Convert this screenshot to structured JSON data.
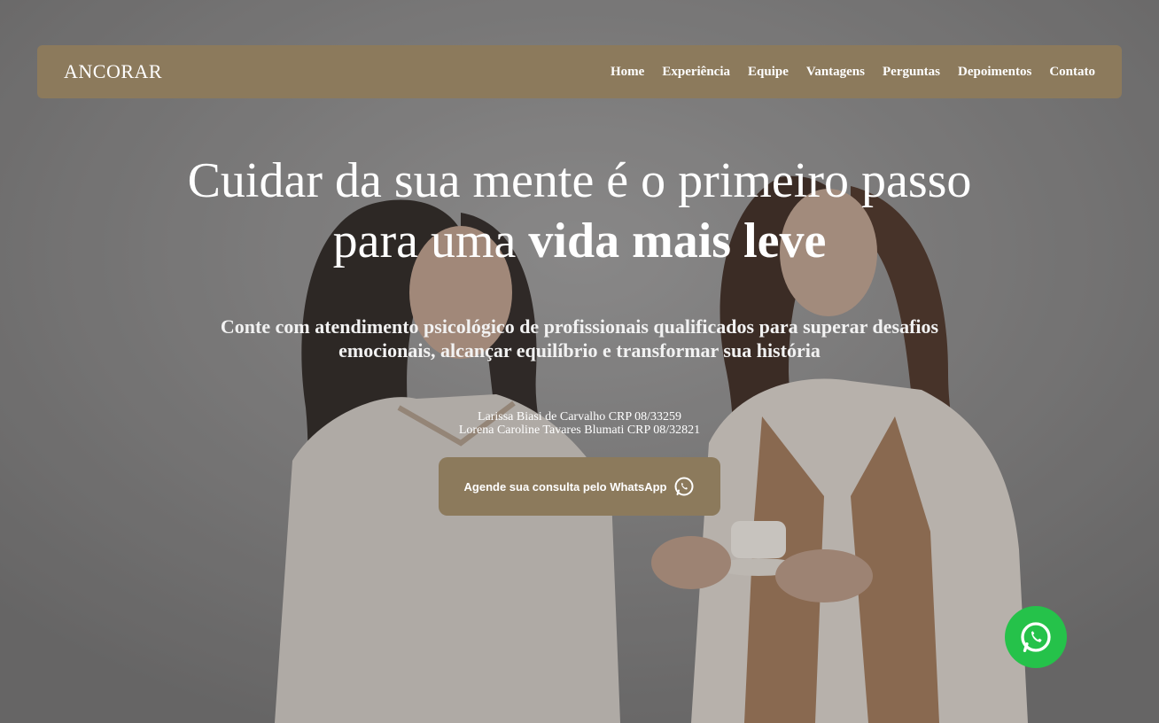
{
  "brand": {
    "logo": "ANCORAR",
    "accent": "#8c7a5c"
  },
  "nav": {
    "items": [
      {
        "label": "Home"
      },
      {
        "label": "Experiência"
      },
      {
        "label": "Equipe"
      },
      {
        "label": "Vantagens"
      },
      {
        "label": "Perguntas"
      },
      {
        "label": "Depoimentos"
      },
      {
        "label": "Contato"
      }
    ]
  },
  "hero": {
    "headline_line1": "Cuidar da sua mente é o primeiro passo",
    "headline_line2_regular": "para uma ",
    "headline_line2_bold": "vida mais leve",
    "subline_line1": "Conte com atendimento psicológico de profissionais qualificados para superar desafios",
    "subline_line2": "emocionais, alcançar equilíbrio e transformar sua história",
    "credit_1": "Larissa Biasi de Carvalho CRP 08/33259",
    "credit_2": "Lorena Caroline Tavares Blumati CRP 08/32821",
    "cta_label": "Agende sua consulta pelo WhatsApp",
    "cta_icon": "whatsapp-icon"
  },
  "floating": {
    "icon": "whatsapp-icon",
    "color": "#25c24a"
  }
}
